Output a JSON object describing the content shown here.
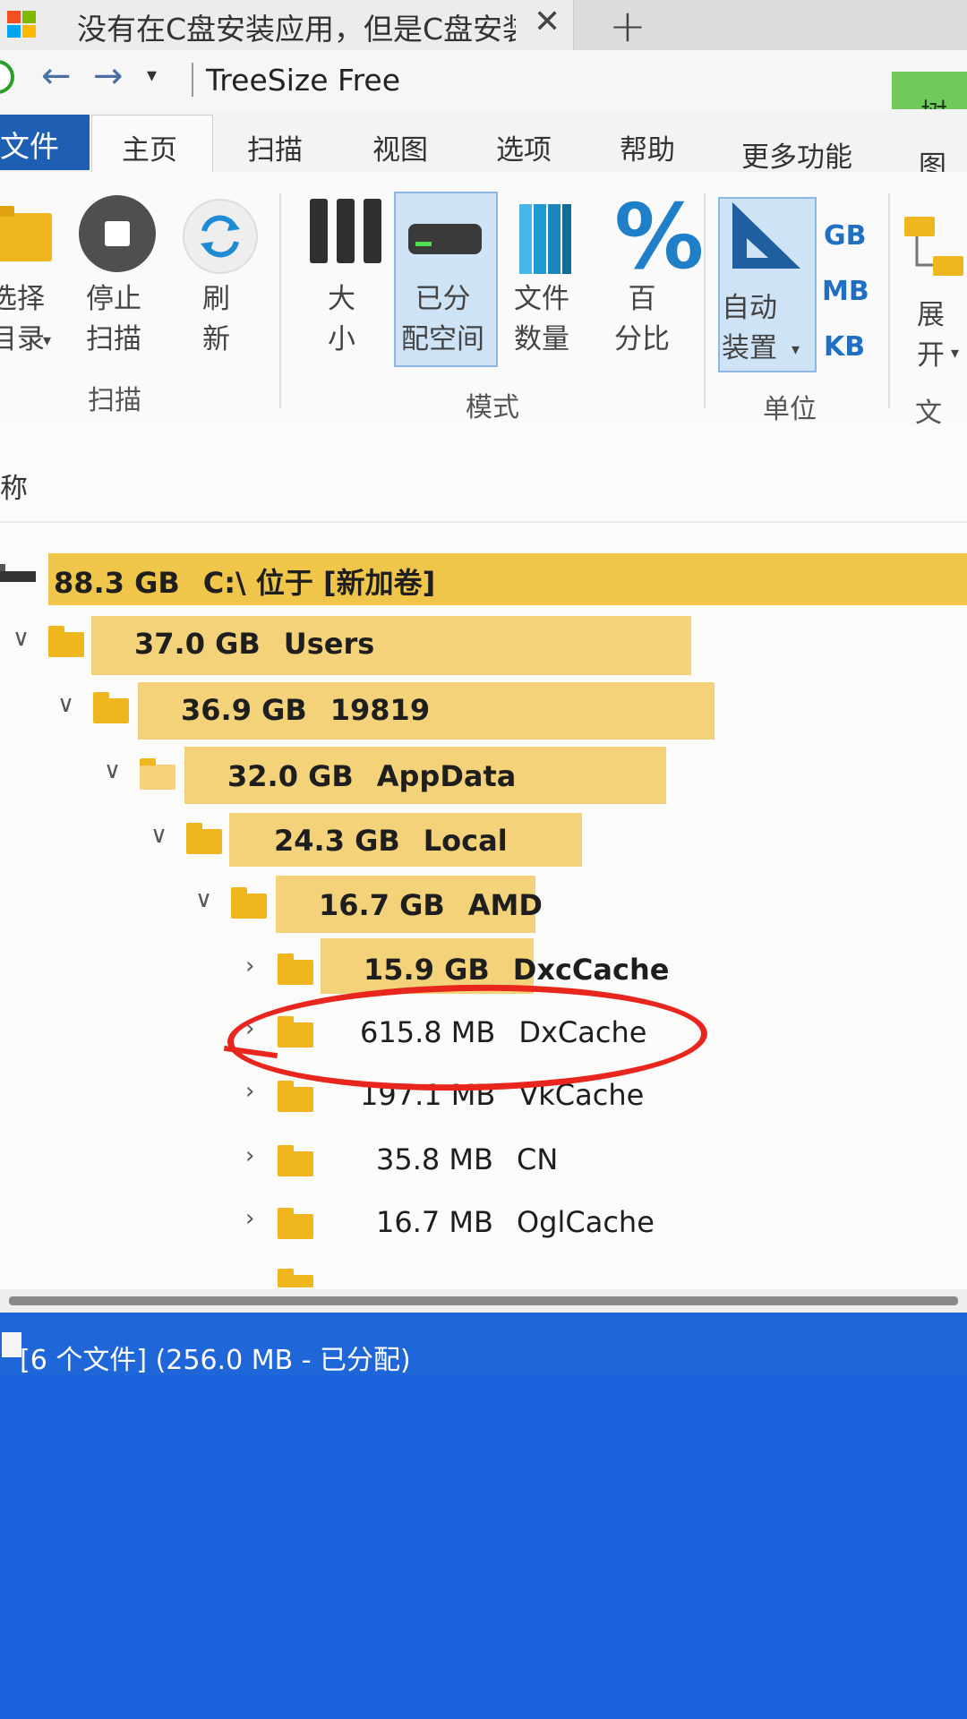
{
  "browser_tab": {
    "title": "没有在C盘安装应用，但是C盘安装",
    "close_glyph": "✕",
    "new_tab_glyph": "+"
  },
  "titlebar": {
    "app_title": "TreeSize Free",
    "context_tab": "树图"
  },
  "menu": {
    "file": "文件",
    "tabs": [
      "主页",
      "扫描",
      "视图",
      "选项",
      "帮助",
      "更多功能"
    ],
    "right_tab": "图表"
  },
  "ribbon": {
    "buttons": {
      "select_dir": "选择\n目录",
      "stop_scan": "停止\n扫描",
      "refresh": "刷\n新",
      "size": "大\n小",
      "allocated": "已分\n配空间",
      "file_count": "文件\n数量",
      "percent": "百\n分比",
      "auto_unit": "自动\n装置",
      "expand": "展\n开"
    },
    "units": [
      "GB",
      "MB",
      "KB"
    ],
    "groups": [
      "扫描",
      "模式",
      "单位",
      "文件"
    ]
  },
  "tree": {
    "column_header": "称",
    "rows": [
      {
        "size": "88.3 GB",
        "name": "C:\\  位于  [新加卷]",
        "bold": true
      },
      {
        "size": "37.0 GB",
        "name": "Users",
        "bold": true
      },
      {
        "size": "36.9 GB",
        "name": "19819",
        "bold": true
      },
      {
        "size": "32.0 GB",
        "name": "AppData",
        "bold": true
      },
      {
        "size": "24.3 GB",
        "name": "Local",
        "bold": true
      },
      {
        "size": "16.7 GB",
        "name": "AMD",
        "bold": true
      },
      {
        "size": "15.9 GB",
        "name": "DxcCache",
        "bold": true
      },
      {
        "size": "615.8 MB",
        "name": "DxCache",
        "bold": false
      },
      {
        "size": "197.1 MB",
        "name": "VkCache",
        "bold": false
      },
      {
        "size": "35.8 MB",
        "name": "CN",
        "bold": false
      },
      {
        "size": "16.7 MB",
        "name": "OglCache",
        "bold": false
      }
    ]
  },
  "status": {
    "text": "[6 个文件] (256.0 MB - 已分配)"
  },
  "colors": {
    "accent_blue": "#1f5fb3",
    "size_bar": "#f3d27a",
    "annotation": "#e8261d",
    "status_bar": "#1f66d8"
  }
}
